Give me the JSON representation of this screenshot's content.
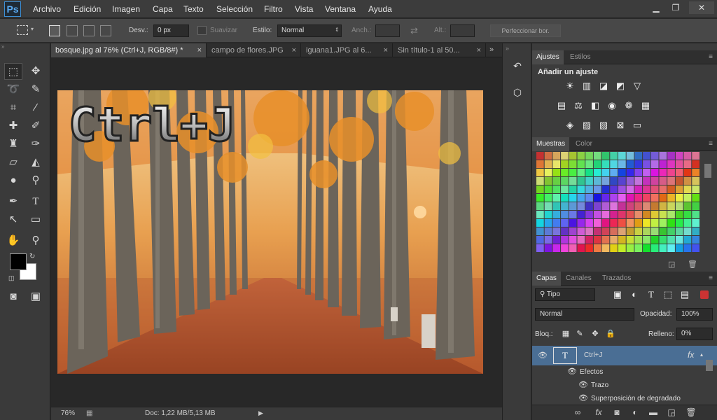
{
  "app": {
    "logo": "Ps"
  },
  "menu": [
    "Archivo",
    "Edición",
    "Imagen",
    "Capa",
    "Texto",
    "Selección",
    "Filtro",
    "Vista",
    "Ventana",
    "Ayuda"
  ],
  "options": {
    "feather_label": "Desv.:",
    "feather_value": "0 px",
    "antialias_label": "Suavizar",
    "style_label": "Estilo:",
    "style_value": "Normal",
    "width_label": "Anch.:",
    "height_label": "Alt.:",
    "refine_label": "Perfeccionar bor."
  },
  "tabs": [
    {
      "label": "bosque.jpg al 76% (Ctrl+J, RGB/8#) *",
      "active": true
    },
    {
      "label": "campo de flores.JPG",
      "active": false
    },
    {
      "label": "iguana1.JPG al 6...",
      "active": false
    },
    {
      "label": "Sin título-1 al 50...",
      "active": false
    }
  ],
  "canvas": {
    "overlay_text": "Ctrl+J"
  },
  "status": {
    "zoom": "76%",
    "doc": "Doc: 1,22 MB/5,13 MB"
  },
  "panels": {
    "adjustments": {
      "tabs": [
        "Ajustes",
        "Estilos"
      ],
      "title": "Añadir un ajuste"
    },
    "swatches": {
      "tabs": [
        "Muestras",
        "Color"
      ]
    },
    "layers": {
      "tabs": [
        "Capas",
        "Canales",
        "Trazados"
      ],
      "filter": "Tipo",
      "blend_mode": "Normal",
      "opacity_label": "Opacidad:",
      "opacity_value": "100%",
      "lock_label": "Bloq.:",
      "fill_label": "Relleno:",
      "fill_value": "0%",
      "layer_name": "Ctrl+J",
      "fx": "fx",
      "effects_label": "Efectos",
      "effects": [
        "Trazo",
        "Superposición de degradado"
      ]
    }
  },
  "colors": {
    "accent": "#4a6e94",
    "foreground": "#000000",
    "background": "#ffffff"
  }
}
